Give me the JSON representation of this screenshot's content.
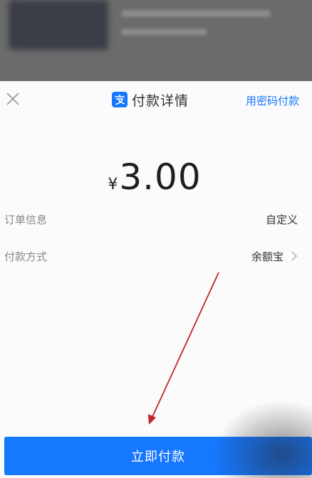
{
  "header": {
    "title": "付款详情",
    "alt_pay_label": "用密码付款",
    "logo_icon": "alipay-logo-icon",
    "close_icon": "close-icon"
  },
  "payment": {
    "currency_symbol": "¥",
    "amount": "3.00"
  },
  "details": [
    {
      "label": "订单信息",
      "value": "自定义"
    },
    {
      "label": "付款方式",
      "value": "余额宝"
    }
  ],
  "button": {
    "label": "立即付款"
  },
  "colors": {
    "accent": "#1677ff",
    "annotation_arrow": "#c0262d"
  }
}
